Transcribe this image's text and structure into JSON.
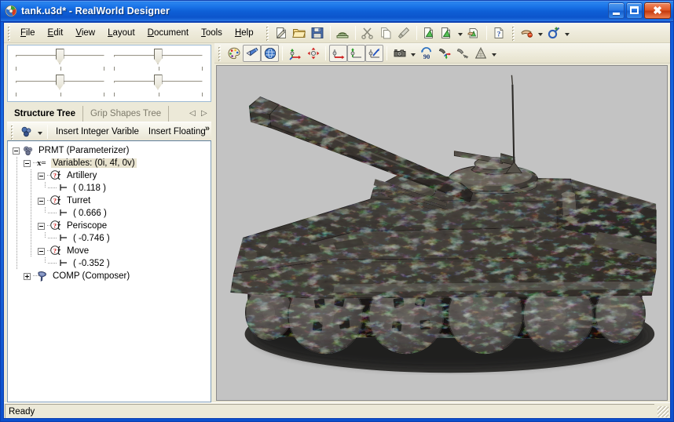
{
  "window": {
    "title": "tank.u3d* - RealWorld Designer",
    "icon": "app-icon",
    "caption_buttons": [
      {
        "name": "minimize",
        "glyph": "_"
      },
      {
        "name": "maximize",
        "glyph": "□"
      },
      {
        "name": "close",
        "glyph": "✕"
      }
    ]
  },
  "menu": {
    "items": [
      {
        "label": "File",
        "accel": "F"
      },
      {
        "label": "Edit",
        "accel": "E"
      },
      {
        "label": "View",
        "accel": "V"
      },
      {
        "label": "Layout",
        "accel": "L"
      },
      {
        "label": "Document",
        "accel": "D"
      },
      {
        "label": "Tools",
        "accel": "T"
      },
      {
        "label": "Help",
        "accel": "H"
      }
    ]
  },
  "main_toolbar": {
    "buttons": [
      {
        "name": "new-document-icon",
        "title": "New"
      },
      {
        "name": "open-folder-icon",
        "title": "Open"
      },
      {
        "name": "save-floppy-icon",
        "title": "Save"
      },
      {
        "name": "print-preview-icon",
        "title": "Print"
      },
      {
        "name": "cut-scissors-icon",
        "title": "Cut"
      },
      {
        "name": "copy-pages-icon",
        "title": "Copy"
      },
      {
        "name": "paste-brush-icon",
        "title": "Paste"
      },
      {
        "name": "insert-shape-icon",
        "title": "Insert Shape"
      },
      {
        "name": "insert-shape-dropdown-icon",
        "title": "Insert Shape Options"
      },
      {
        "name": "apply-shape-icon",
        "title": "Apply"
      },
      {
        "name": "help-question-icon",
        "title": "Help"
      },
      {
        "name": "render-icon",
        "title": "Render"
      },
      {
        "name": "render-dropdown-icon",
        "title": "Render Options"
      },
      {
        "name": "add-object-icon",
        "title": "Add Object"
      },
      {
        "name": "add-object-dropdown-icon",
        "title": "Add Object Options"
      }
    ]
  },
  "sliders": {
    "count": 4,
    "values": [
      0.5,
      0.5,
      0.5,
      0.5
    ],
    "ticks": [
      0,
      50,
      100
    ]
  },
  "tabs": {
    "items": [
      {
        "label": "Structure Tree",
        "active": true
      },
      {
        "label": "Grip Shapes Tree",
        "active": false
      }
    ],
    "scroll_left": "◁",
    "scroll_right": "▷"
  },
  "tree_toolbar": {
    "dropdown_icon": "variables-icon",
    "actions": [
      {
        "label": "Insert Integer Varible"
      },
      {
        "label": "Insert Floating"
      }
    ],
    "overflow": "»"
  },
  "tree": {
    "nodes": [
      {
        "depth": 0,
        "expander": "minus",
        "icon": "parameterizer-icon",
        "label": "PRMT (Parameterizer)",
        "selected": false
      },
      {
        "depth": 1,
        "expander": "minus",
        "icon": "variables-xeq-icon",
        "label": "Variables: (0i, 4f, 0v)",
        "selected": true
      },
      {
        "depth": 2,
        "expander": "minus",
        "icon": "float-variable-icon",
        "label": "Artillery",
        "selected": false
      },
      {
        "depth": 3,
        "expander": "none",
        "icon": "value-handle-icon",
        "label": "( 0.118 )",
        "selected": false
      },
      {
        "depth": 2,
        "expander": "minus",
        "icon": "float-variable-icon",
        "label": "Turret",
        "selected": false
      },
      {
        "depth": 3,
        "expander": "none",
        "icon": "value-handle-icon",
        "label": "( 0.666 )",
        "selected": false
      },
      {
        "depth": 2,
        "expander": "minus",
        "icon": "float-variable-icon",
        "label": "Periscope",
        "selected": false
      },
      {
        "depth": 3,
        "expander": "none",
        "icon": "value-handle-icon",
        "label": "( -0.746 )",
        "selected": false
      },
      {
        "depth": 2,
        "expander": "minus",
        "icon": "float-variable-icon",
        "label": "Move",
        "selected": false
      },
      {
        "depth": 3,
        "expander": "none",
        "icon": "value-handle-icon",
        "label": "( -0.352 )",
        "selected": false
      },
      {
        "depth": 1,
        "expander": "plus",
        "icon": "composer-icon",
        "label": "COMP (Composer)",
        "selected": false
      }
    ]
  },
  "view_toolbar": {
    "buttons": [
      {
        "name": "palette-colors-icon",
        "pressed": false
      },
      {
        "name": "flashlight-icon",
        "pressed": true
      },
      {
        "name": "globe-environment-icon",
        "pressed": true
      },
      {
        "name": "axis-move-icon",
        "pressed": false
      },
      {
        "name": "pan-arrows-icon",
        "pressed": false
      },
      {
        "name": "axis-rotate-x-icon",
        "pressed": true
      },
      {
        "name": "axis-rotate-y-icon",
        "pressed": true
      },
      {
        "name": "axis-rotate-z-icon",
        "pressed": true
      },
      {
        "name": "camera-icon",
        "pressed": false
      },
      {
        "name": "camera-dropdown-icon",
        "pressed": false
      },
      {
        "name": "rotate-90-icon",
        "pressed": false
      },
      {
        "name": "light-axis-icon",
        "pressed": false
      },
      {
        "name": "light-gray-icon",
        "pressed": false
      },
      {
        "name": "cone-shape-icon",
        "pressed": false
      },
      {
        "name": "cone-dropdown-icon",
        "pressed": false
      }
    ]
  },
  "viewport": {
    "model": "tank",
    "background_color": "#c3c3c3",
    "shadow_color": "#2a2a28"
  },
  "statusbar": {
    "text": "Ready",
    "resize_grip": "resize-grip"
  },
  "colors": {
    "title_blue": "#0c55cc",
    "face": "#ece9d8",
    "selection": "#e8e3cf",
    "tree_border": "#7f9db9",
    "viewport_bg": "#c3c3c3"
  }
}
